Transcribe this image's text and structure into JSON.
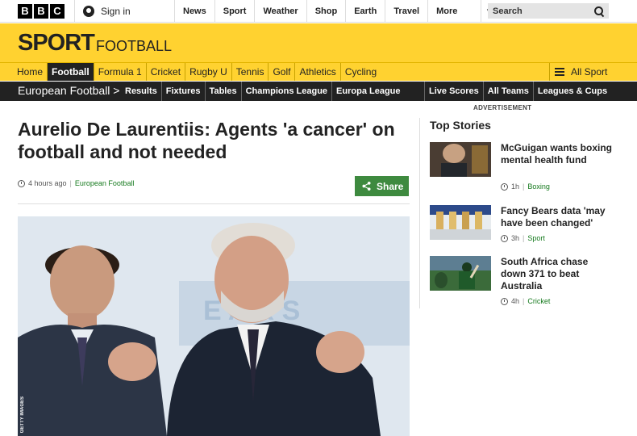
{
  "header": {
    "logo_letters": [
      "B",
      "B",
      "C"
    ],
    "signin": "Sign in",
    "nav": [
      "News",
      "Sport",
      "Weather",
      "Shop",
      "Earth",
      "Travel"
    ],
    "more": "More",
    "search_placeholder": "Search"
  },
  "banner": {
    "sport": "SPORT",
    "section": "FOOTBALL"
  },
  "subnav": {
    "items": [
      "Home",
      "Football",
      "Formula 1",
      "Cricket",
      "Rugby U",
      "Tennis",
      "Golf",
      "Athletics",
      "Cycling"
    ],
    "active_index": 1,
    "all_sport": "All Sport"
  },
  "section_nav": {
    "title": "European Football >",
    "links": [
      "Results",
      "Fixtures",
      "Tables",
      "Champions League",
      "Europa League"
    ],
    "right_links": [
      "Live Scores",
      "All Teams",
      "Leagues & Cups"
    ]
  },
  "advert_label": "ADVERTISEMENT",
  "article": {
    "headline": "Aurelio De Laurentiis: Agents 'a cancer' on football and not needed",
    "time": "4 hours ago",
    "topic": "European Football",
    "share": "Share",
    "image_credit": "GETTY IMAGES"
  },
  "sidebar": {
    "heading": "Top Stories",
    "stories": [
      {
        "title": "McGuigan wants boxing mental health fund",
        "time": "1h",
        "topic": "Boxing"
      },
      {
        "title": "Fancy Bears data 'may have been changed'",
        "time": "3h",
        "topic": "Sport"
      },
      {
        "title": "South Africa chase down 371 to beat Australia",
        "time": "4h",
        "topic": "Cricket"
      }
    ]
  },
  "colors": {
    "sport_yellow": "#ffd230",
    "share_green": "#3e8a3f",
    "link_green": "#167a1e",
    "dark_bar": "#222222"
  }
}
